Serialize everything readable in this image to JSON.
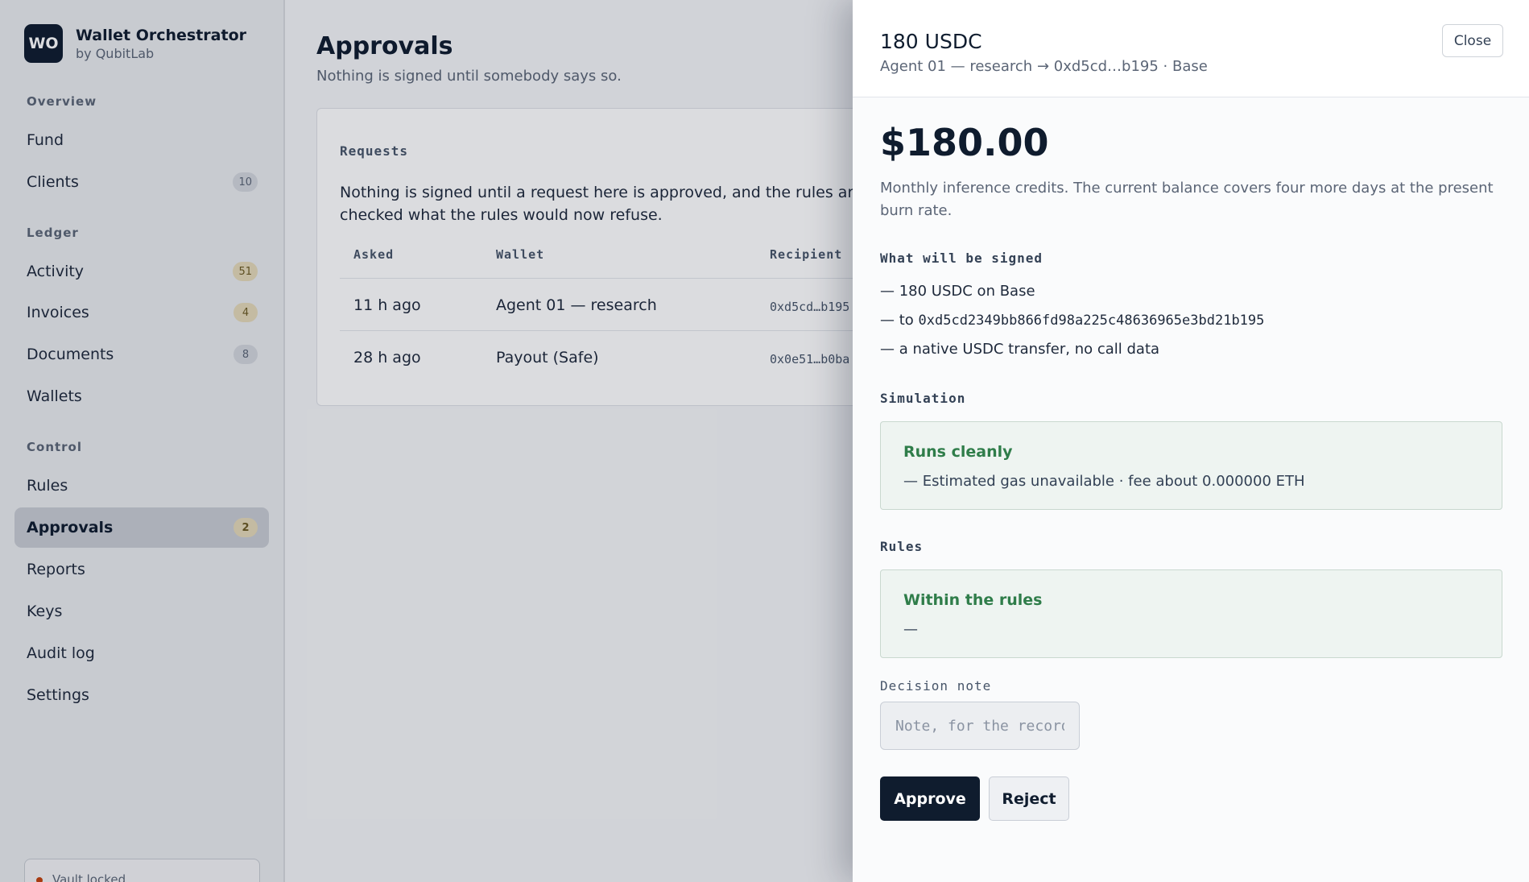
{
  "app": {
    "logo_initials": "WO",
    "name": "Wallet Orchestrator",
    "by": "by QubitLab"
  },
  "sidebar": {
    "sections": [
      {
        "label": "Overview"
      },
      {
        "label": "Ledger"
      },
      {
        "label": "Control"
      }
    ],
    "items": [
      {
        "label": "Fund",
        "badge": ""
      },
      {
        "label": "Clients",
        "badge": "10"
      },
      {
        "label": "Activity",
        "badge": "51"
      },
      {
        "label": "Invoices",
        "badge": "4"
      },
      {
        "label": "Documents",
        "badge": "8"
      },
      {
        "label": "Wallets",
        "badge": ""
      },
      {
        "label": "Rules",
        "badge": ""
      },
      {
        "label": "Approvals",
        "badge": "2",
        "active": true
      },
      {
        "label": "Reports",
        "badge": ""
      },
      {
        "label": "Keys",
        "badge": ""
      },
      {
        "label": "Audit log",
        "badge": ""
      },
      {
        "label": "Settings",
        "badge": ""
      }
    ],
    "vault_status": "Vault locked"
  },
  "main": {
    "title": "Approvals",
    "subtitle": "Nothing is signed until somebody says so.",
    "card": {
      "label": "Requests",
      "text": "Nothing is signed until a request here is approved, and the rules are checked what the rules would now refuse.",
      "columns": [
        "Asked",
        "Wallet",
        "Recipient"
      ],
      "rows": [
        {
          "asked": "11 h ago",
          "wallet": "Agent 01 — research",
          "recipient": "0xd5cd…b195"
        },
        {
          "asked": "28 h ago",
          "wallet": "Payout (Safe)",
          "recipient": "0x0e51…b0ba"
        }
      ]
    }
  },
  "drawer": {
    "title": "180 USDC",
    "subtitle": "Agent 01 — research → 0xd5cd…b195 · Base",
    "close_label": "Close",
    "amount": "$180.00",
    "memo": "Monthly inference credits. The current balance covers four more days at the present burn rate.",
    "signed_label": "What will be signed",
    "signed_items": {
      "line1": "— 180 USDC on Base",
      "line2_prefix": "— to ",
      "line2_address": "0xd5cd2349bb866fd98a225c48636965e3bd21b195",
      "line3": "— a native USDC transfer, no call data"
    },
    "simulation": {
      "label": "Simulation",
      "status": "Runs cleanly",
      "detail": "— Estimated gas unavailable · fee about 0.000000 ETH"
    },
    "rules": {
      "label": "Rules",
      "status": "Within the rules",
      "detail": "—"
    },
    "note": {
      "label": "Decision note",
      "placeholder": "Note, for the record",
      "value": ""
    },
    "approve_label": "Approve",
    "reject_label": "Reject"
  },
  "colors": {
    "brand": "#0f1c2e",
    "success": "#2f7d4a",
    "success_bg": "#eef4f1",
    "vault_dot": "#c2410c"
  }
}
